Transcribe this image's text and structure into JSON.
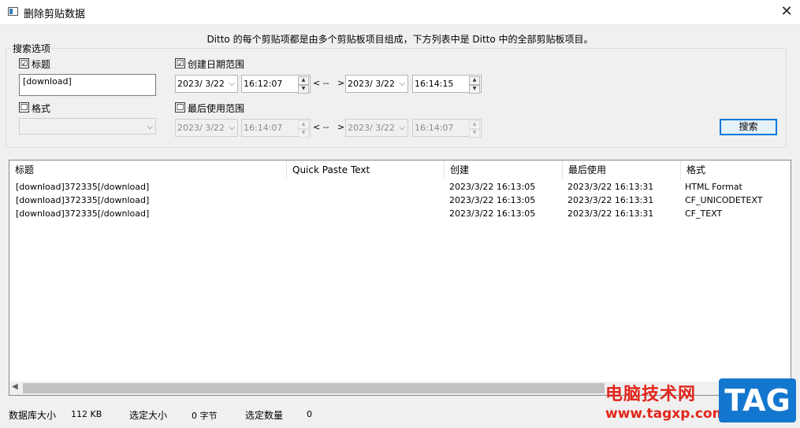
{
  "window": {
    "title": "删除剪贴数据",
    "close_glyph": "✕"
  },
  "info_text": "Ditto 的每个剪贴项都是由多个剪贴板项目组成，下方列表中是 Ditto 中的全部剪贴板项目。",
  "search_options": {
    "group_label": "搜索选项",
    "title": {
      "checked": "☑",
      "label": "标题",
      "value": "[download]"
    },
    "format": {
      "checked": "☐",
      "label": "格式",
      "value": ""
    },
    "created_range": {
      "checked": "☑",
      "label": "创建日期范围",
      "from_date": "2023/ 3/22",
      "from_time": "16:12:07",
      "sep_left": "< --",
      "sep_right": ">",
      "to_date": "2023/ 3/22",
      "to_time": "16:14:15"
    },
    "last_used_range": {
      "checked": "☐",
      "label": "最后使用范围",
      "from_date": "2023/ 3/22",
      "from_time": "16:14:07",
      "sep_left": "< --",
      "sep_right": ">",
      "to_date": "2023/ 3/22",
      "to_time": "16:14:07"
    },
    "search_button": "搜索"
  },
  "list": {
    "columns": [
      "标题",
      "Quick Paste Text",
      "创建",
      "最后使用",
      "格式"
    ],
    "rows": [
      [
        "[download]372335[/download]",
        "",
        "2023/3/22 16:13:05",
        "2023/3/22 16:13:31",
        "HTML Format"
      ],
      [
        "[download]372335[/download]",
        "",
        "2023/3/22 16:13:05",
        "2023/3/22 16:13:31",
        "CF_UNICODETEXT"
      ],
      [
        "[download]372335[/download]",
        "",
        "2023/3/22 16:13:05",
        "2023/3/22 16:13:31",
        "CF_TEXT"
      ]
    ]
  },
  "status": {
    "db_size_label": "数据库大小",
    "db_size_value": "112 KB",
    "selected_size_label": "选定大小",
    "selected_size_value": "0 字节",
    "selected_count_label": "选定数量",
    "selected_count_value": "0"
  },
  "watermark": {
    "line1": "电脑技术网",
    "line2": "www.tagxp.com",
    "badge": "TAG"
  }
}
